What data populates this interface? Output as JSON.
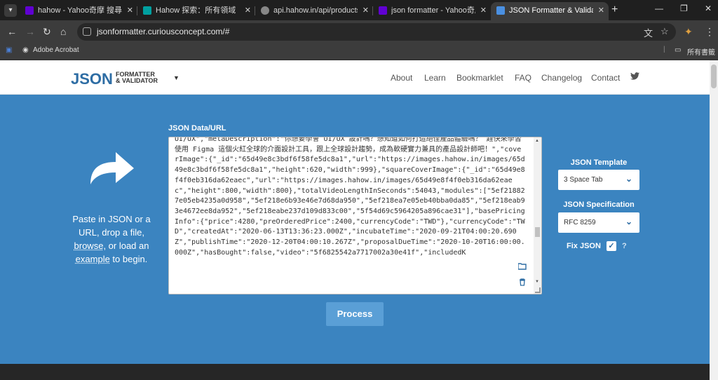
{
  "browser": {
    "tabs": [
      {
        "title": "hahow - Yahoo奇摩 搜尋結果",
        "favicon_color": "#6001d2"
      },
      {
        "title": "Hahow 探索：所有領域",
        "favicon_color": "#00a0a0"
      },
      {
        "title": "api.hahow.in/api/products/se",
        "favicon_color": "#888888"
      },
      {
        "title": "json formatter - Yahoo奇摩 搜",
        "favicon_color": "#6001d2"
      },
      {
        "title": "JSON Formatter & Validator",
        "favicon_color": "#4a90e2"
      }
    ],
    "url": "jsonformatter.curiousconcept.com/#",
    "bookmarks": {
      "acrobat": "Adobe Acrobat",
      "all": "所有書籤"
    }
  },
  "site": {
    "logo_big": "JSON",
    "logo_small_1": "FORMATTER",
    "logo_small_2": "& VALIDATOR",
    "nav": [
      "About",
      "Learn",
      "Bookmarklet",
      "FAQ",
      "Changelog",
      "Contact"
    ]
  },
  "intro": {
    "t1": "Paste in JSON or a URL, drop a file,",
    "browse": "browse",
    "t2": ", or load an",
    "example": "example",
    "t3": " to begin."
  },
  "editor": {
    "label": "JSON Data/URL",
    "content": "UI/UX\",\"metaDescription\":\"你想要學會 UI/UX 設計嗎？想知道如何打造絕佳產品體驗嗎？ 趕快來學習使用 Figma 這個火紅全球的介面設計工具，跟上全球設計趨勢，成為軟硬實力兼具的產品設計師吧！\",\"coverImage\":{\"_id\":\"65d49e8c3bdf6f58fe5dc8a1\",\"url\":\"https://images.hahow.in/images/65d49e8c3bdf6f58fe5dc8a1\",\"height\":620,\"width\":999},\"squareCoverImage\":{\"_id\":\"65d49e8f4f0eb316da62eaec\",\"url\":\"https://images.hahow.in/images/65d49e8f4f0eb316da62eaec\",\"height\":800,\"width\":800},\"totalVideoLengthInSeconds\":54043,\"modules\":[\"5ef218827e05eb4235a0d958\",\"5ef218e6b93e46e7d68da950\",\"5ef218ea7e05eb40bba0da85\",\"5ef218eab93e4672ee8da952\",\"5ef218eabe237d109d833c00\",\"5f54d69c5964205a896cae31\"],\"basePricingInfo\":{\"price\":4280,\"preOrderedPrice\":2400,\"currencyCode\":\"TWD\"},\"currencyCode\":\"TWD\",\"createdAt\":\"2020-06-13T13:36:23.000Z\",\"incubateTime\":\"2020-09-21T04:00:20.690Z\",\"publishTime\":\"2020-12-20T04:00:10.267Z\",\"proposalDueTime\":\"2020-10-20T16:00:00.000Z\",\"hasBought\":false,\"video\":\"5f6825542a7717002a30e41f\",\"includedK"
  },
  "process_label": "Process",
  "options": {
    "template_label": "JSON Template",
    "template_value": "3 Space Tab",
    "spec_label": "JSON Specification",
    "spec_value": "RFC 8259",
    "fix_label": "Fix JSON",
    "fix_checked": true,
    "help": "?"
  },
  "colors": {
    "hero": "#3b84c0",
    "brand": "#2e6da4",
    "button": "#5a9fd6"
  }
}
